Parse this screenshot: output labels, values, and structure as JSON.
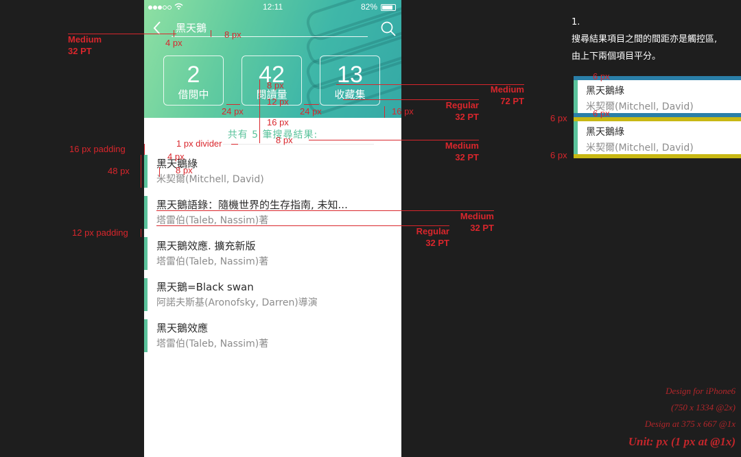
{
  "status_bar": {
    "time": "12:11",
    "battery": "82%"
  },
  "search": {
    "query": "黑天鵝"
  },
  "stats": [
    {
      "value": "2",
      "label": "借閱中"
    },
    {
      "value": "42",
      "label": "閱讀量"
    },
    {
      "value": "13",
      "label": "收藏集"
    }
  ],
  "result_count": "共有 5 筆搜尋結果:",
  "results": [
    {
      "title": "黑天鵝綠",
      "author": "米契爾(Mitchell, David)"
    },
    {
      "title": "黑天鵝語錄：隨機世界的生存指南, 未知...",
      "author": "塔雷伯(Taleb, Nassim)著"
    },
    {
      "title": "黑天鵝效應. 擴充新版",
      "author": "塔雷伯(Taleb, Nassim)著"
    },
    {
      "title": "黑天鵝=Black swan",
      "author": "阿諾夫斯基(Aronofsky, Darren)導演"
    },
    {
      "title": "黑天鵝效應",
      "author": "塔雷伯(Taleb, Nassim)著"
    }
  ],
  "annotations": {
    "medium_32pt_a": "Medium",
    "pt32": "32 PT",
    "px8": "8 px",
    "px4": "4 px",
    "px24": "24 px",
    "px12": "12 px",
    "px16": "16 px",
    "px6": "6 px",
    "px48": "48 px",
    "pt72": "72 PT",
    "medium": "Medium",
    "regular": "Regular",
    "divider": "1 px divider",
    "pad16": "16 px padding",
    "pad12": "12 px padding"
  },
  "right_note": {
    "number": "1.",
    "line1": "搜尋結果項目之間的間距亦是觸控區,",
    "line2": "由上下兩個項目平分。"
  },
  "sample_items": [
    {
      "title": "黑天鵝綠",
      "author": "米契爾(Mitchell, David)"
    },
    {
      "title": "黑天鵝綠",
      "author": "米契爾(Mitchell, David)"
    }
  ],
  "footer": {
    "line1": "Design for iPhone6",
    "line2": "(750 x 1334 @2x)",
    "line3": "Design at 375 x 667 @1x",
    "line4": "Unit: px (1 px at @1x)"
  },
  "colors": {
    "accent": "#5bc39c",
    "annotation": "#d9262c",
    "stripe_blue": "#2a7fa8",
    "stripe_yellow": "#c8b814"
  }
}
